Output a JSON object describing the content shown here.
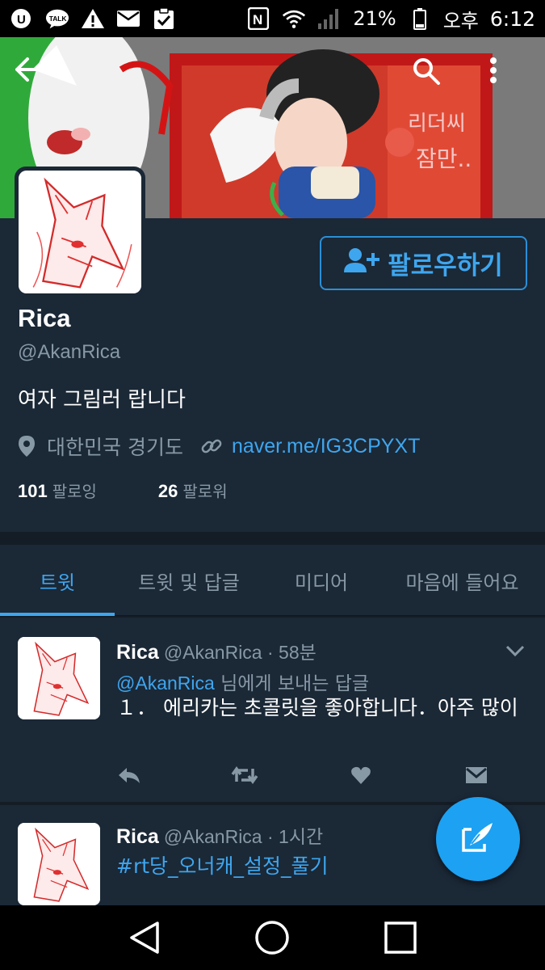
{
  "status_bar": {
    "battery": "21%",
    "ampm": "오후",
    "time": "6:12",
    "left_icons": [
      "u-plus-icon",
      "kakaotalk-icon",
      "warning-icon",
      "mail-icon",
      "clipboard-check-icon"
    ],
    "right_icons": [
      "nfc-icon",
      "wifi-icon",
      "signal-icon",
      "battery-icon"
    ]
  },
  "banner": {
    "art_text": "리더씨\n잠만..",
    "back": "back-arrow-icon",
    "search": "search-icon",
    "more": "more-vert-icon"
  },
  "profile": {
    "follow_label": "팔로우하기",
    "name": "Rica",
    "handle": "@AkanRica",
    "bio": "여자 그림러 랍니다",
    "location": "대한민국 경기도",
    "link": "naver.me/IG3CPYXT",
    "following_count": "101",
    "following_label": "팔로잉",
    "followers_count": "26",
    "followers_label": "팔로워"
  },
  "tabs": [
    {
      "label": "트윗",
      "active": true
    },
    {
      "label": "트윗 및 답글",
      "active": false
    },
    {
      "label": "미디어",
      "active": false
    },
    {
      "label": "마음에 들어요",
      "active": false
    }
  ],
  "tweets": [
    {
      "name": "Rica",
      "handle": "@AkanRica",
      "time": "· 58분",
      "reply_to": "@AkanRica",
      "reply_suffix": " 님에게 보내는 답글",
      "text": "１．  에리카는 초콜릿을 좋아합니다．아주 많이"
    },
    {
      "name": "Rica",
      "handle": "@AkanRica",
      "time": "· 1시간",
      "hashtag": "#rt당_오너캐_설정_풀기"
    }
  ],
  "colors": {
    "accent": "#3ea6ef",
    "background": "#141d26",
    "card": "#1b2836",
    "muted": "#8899a6",
    "fab": "#1da1f2"
  }
}
